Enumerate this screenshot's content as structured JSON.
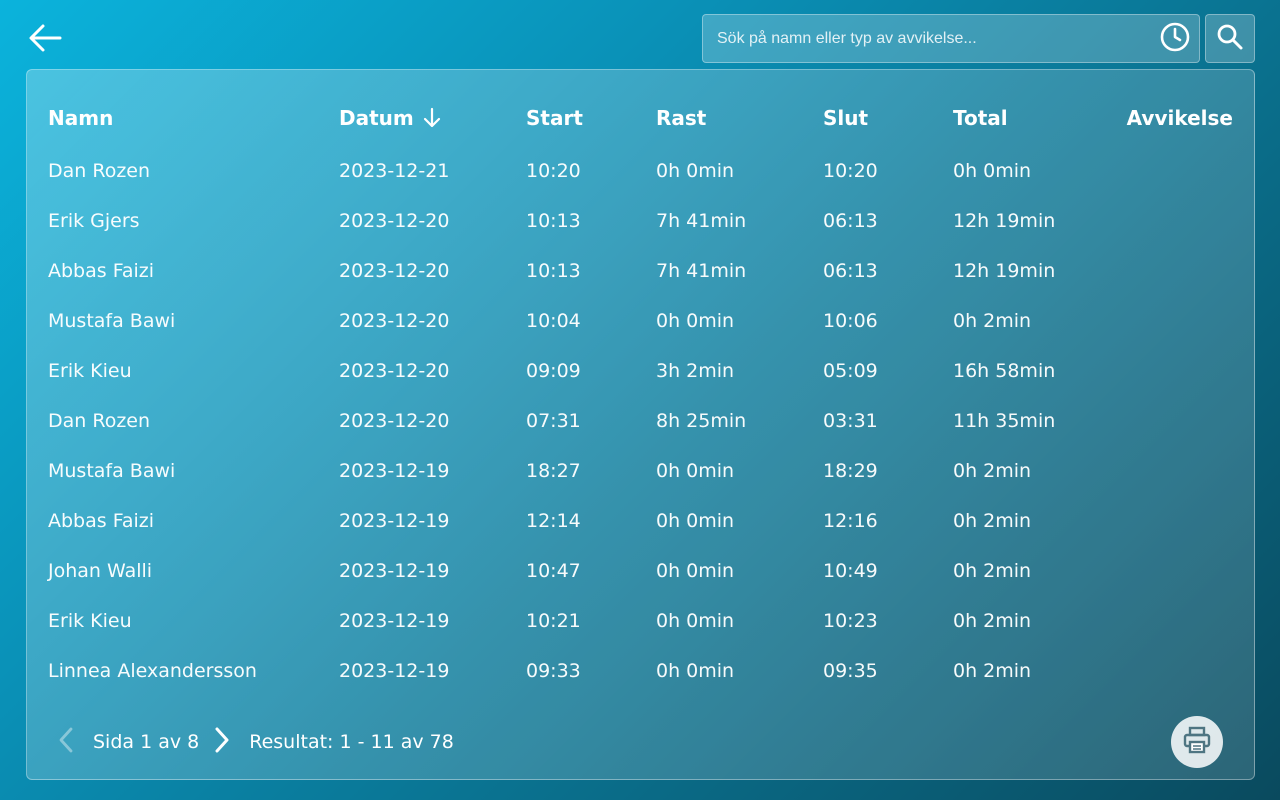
{
  "search": {
    "placeholder": "Sök på namn eller typ av avvikelse...",
    "value": ""
  },
  "icons": {
    "back": "arrow-left-icon",
    "history": "clock-icon",
    "search": "search-icon",
    "sort": "arrow-down-icon",
    "prev": "chevron-left-icon",
    "next": "chevron-right-icon",
    "print": "printer-icon"
  },
  "table": {
    "headers": {
      "name": "Namn",
      "date": "Datum",
      "start": "Start",
      "rast": "Rast",
      "slut": "Slut",
      "total": "Total",
      "avvikelse": "Avvikelse"
    },
    "rows": [
      {
        "name": "Dan Rozen",
        "date": "2023-12-21",
        "start": "10:20",
        "rast": "0h 0min",
        "slut": "10:20",
        "total": "0h 0min",
        "avvikelse": ""
      },
      {
        "name": "Erik Gjers",
        "date": "2023-12-20",
        "start": "10:13",
        "rast": "7h 41min",
        "slut": "06:13",
        "total": "12h 19min",
        "avvikelse": ""
      },
      {
        "name": "Abbas Faizi",
        "date": "2023-12-20",
        "start": "10:13",
        "rast": "7h 41min",
        "slut": "06:13",
        "total": "12h 19min",
        "avvikelse": ""
      },
      {
        "name": "Mustafa Bawi",
        "date": "2023-12-20",
        "start": "10:04",
        "rast": "0h 0min",
        "slut": "10:06",
        "total": "0h 2min",
        "avvikelse": ""
      },
      {
        "name": "Erik Kieu",
        "date": "2023-12-20",
        "start": "09:09",
        "rast": "3h 2min",
        "slut": "05:09",
        "total": "16h 58min",
        "avvikelse": ""
      },
      {
        "name": "Dan Rozen",
        "date": "2023-12-20",
        "start": "07:31",
        "rast": "8h 25min",
        "slut": "03:31",
        "total": "11h 35min",
        "avvikelse": ""
      },
      {
        "name": "Mustafa Bawi",
        "date": "2023-12-19",
        "start": "18:27",
        "rast": "0h 0min",
        "slut": "18:29",
        "total": "0h 2min",
        "avvikelse": ""
      },
      {
        "name": "Abbas Faizi",
        "date": "2023-12-19",
        "start": "12:14",
        "rast": "0h 0min",
        "slut": "12:16",
        "total": "0h 2min",
        "avvikelse": ""
      },
      {
        "name": "Johan Walli",
        "date": "2023-12-19",
        "start": "10:47",
        "rast": "0h 0min",
        "slut": "10:49",
        "total": "0h 2min",
        "avvikelse": ""
      },
      {
        "name": "Erik Kieu",
        "date": "2023-12-19",
        "start": "10:21",
        "rast": "0h 0min",
        "slut": "10:23",
        "total": "0h 2min",
        "avvikelse": ""
      },
      {
        "name": "Linnea Alexandersson",
        "date": "2023-12-19",
        "start": "09:33",
        "rast": "0h 0min",
        "slut": "09:35",
        "total": "0h 2min",
        "avvikelse": ""
      }
    ]
  },
  "pagination": {
    "page_label": "Sida 1 av 8",
    "result_label": "Resultat: 1 - 11 av 78"
  }
}
